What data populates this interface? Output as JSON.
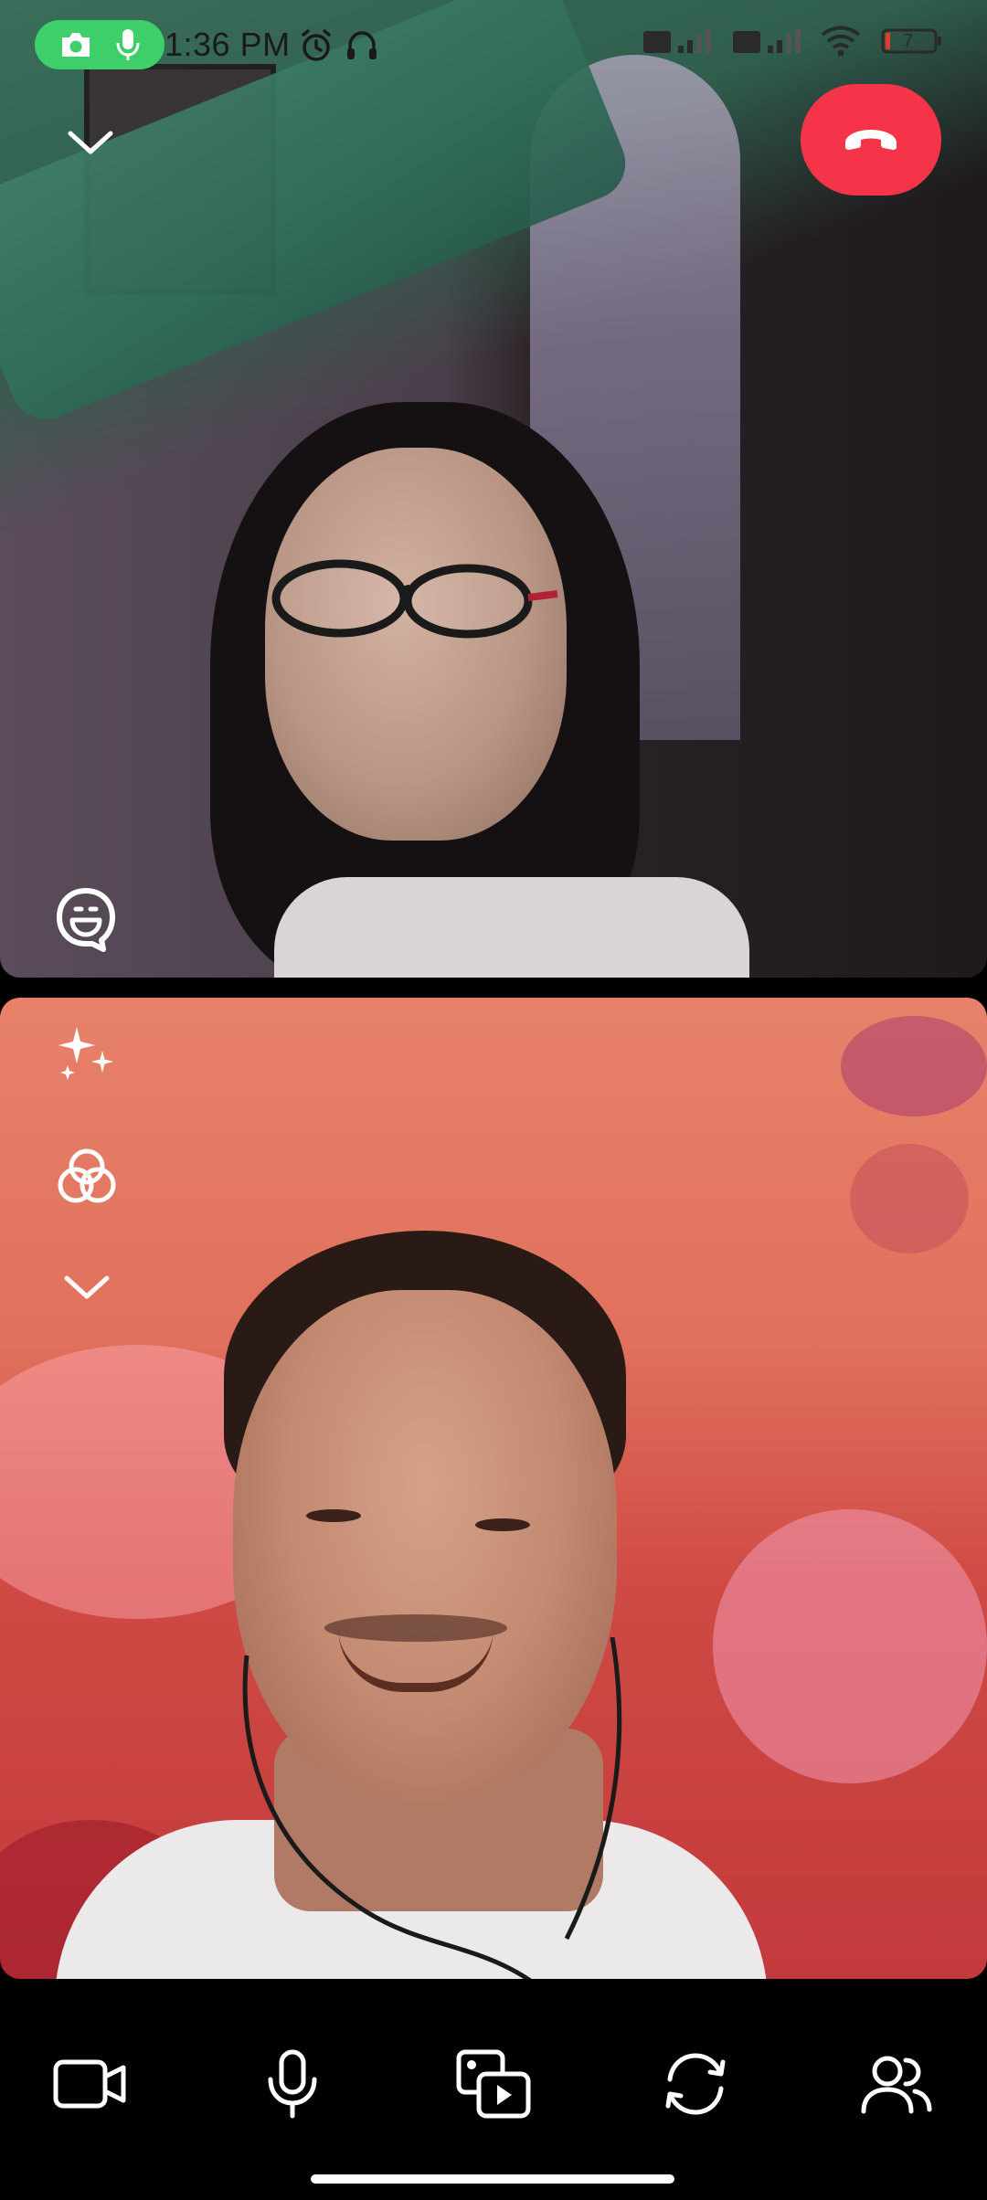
{
  "status_bar": {
    "time": "1:36 PM",
    "recording_indicator": {
      "icons": [
        "camera-icon",
        "microphone-icon"
      ],
      "color": "#3ecf6b"
    },
    "left_icons": [
      "alarm-icon",
      "headset-icon"
    ],
    "right_icons": [
      "sim-1-signal-icon",
      "sim-2-signal-icon",
      "wifi-icon",
      "battery-icon"
    ],
    "battery_level": "7"
  },
  "call": {
    "minimize_icon": "chevron-down-icon",
    "end_call_icon": "end-call-icon",
    "end_call_color": "#f53449",
    "remote_tile": {
      "sticker_icon": "sticker-icon"
    },
    "local_tile": {
      "effects_icon": "sparkles-icon",
      "filters_icon": "filters-icon",
      "collapse_icon": "chevron-down-icon"
    }
  },
  "toolbar": {
    "buttons": [
      {
        "icon": "video-camera-icon"
      },
      {
        "icon": "microphone-icon"
      },
      {
        "icon": "media-share-icon"
      },
      {
        "icon": "flip-camera-icon"
      },
      {
        "icon": "participants-icon"
      }
    ]
  }
}
